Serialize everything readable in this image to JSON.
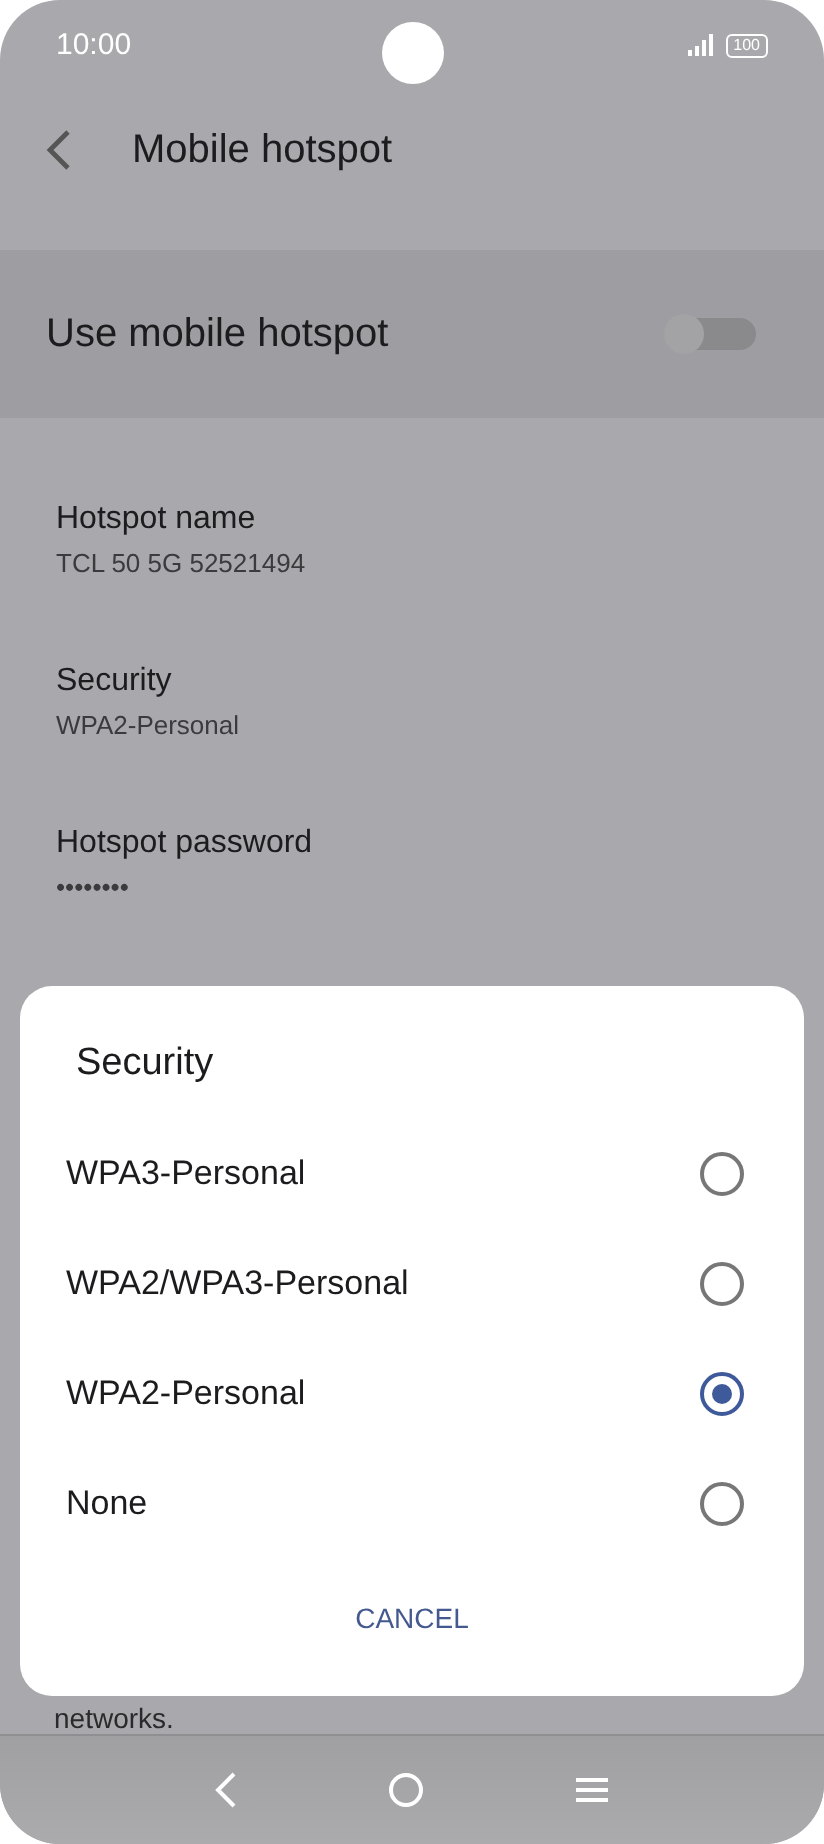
{
  "status_bar": {
    "time": "10:00",
    "battery": "100"
  },
  "header": {
    "title": "Mobile hotspot"
  },
  "master_switch": {
    "label": "Use mobile hotspot",
    "on": false
  },
  "settings": [
    {
      "title": "Hotspot name",
      "value": "TCL 50 5G 52521494"
    },
    {
      "title": "Security",
      "value": "WPA2-Personal"
    },
    {
      "title": "Hotspot password",
      "value": "••••••••"
    }
  ],
  "footnote": "networks.",
  "dialog": {
    "title": "Security",
    "options": [
      {
        "label": "WPA3-Personal",
        "selected": false
      },
      {
        "label": "WPA2/WPA3-Personal",
        "selected": false
      },
      {
        "label": "WPA2-Personal",
        "selected": true
      },
      {
        "label": "None",
        "selected": false
      }
    ],
    "button": "CANCEL"
  }
}
